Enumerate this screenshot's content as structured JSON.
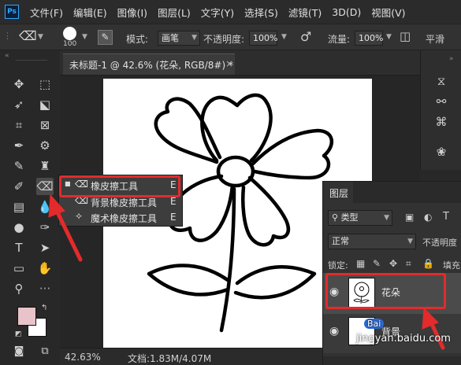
{
  "app": {
    "logo": "Ps"
  },
  "menu": [
    "文件(F)",
    "编辑(E)",
    "图像(I)",
    "图层(L)",
    "文字(Y)",
    "选择(S)",
    "滤镜(T)",
    "3D(D)",
    "视图(V)"
  ],
  "options": {
    "brush_size": "100",
    "mode_label": "模式:",
    "mode_value": "画笔",
    "opacity_label": "不透明度:",
    "opacity_value": "100%",
    "flow_label": "流量:",
    "flow_value": "100%",
    "smooth_label": "平滑"
  },
  "document": {
    "tab_title": "未标题-1 @ 42.6% (花朵, RGB/8#) *",
    "close": "×"
  },
  "status": {
    "zoom": "42.63%",
    "doc_size": "文档:1.83M/4.07M"
  },
  "flyout": {
    "items": [
      {
        "label": "橡皮擦工具",
        "key": "E",
        "icon": "eraser-icon"
      },
      {
        "label": "背景橡皮擦工具",
        "key": "E",
        "icon": "background-eraser-icon"
      },
      {
        "label": "魔术橡皮擦工具",
        "key": "E",
        "icon": "magic-eraser-icon"
      }
    ]
  },
  "layers_panel": {
    "tab": "图层",
    "filter_kind": "类型",
    "blend_mode": "正常",
    "opacity_label": "不透明度",
    "lock_label": "锁定:",
    "fill_label": "填充",
    "layers": [
      {
        "name": "花朵",
        "visible": true
      },
      {
        "name": "背景",
        "visible": true
      }
    ]
  },
  "colors": {
    "foreground": "#e9c3ca",
    "background": "#ffffff",
    "highlight": "#e32b2b"
  },
  "watermark": "jingyan.baidu.com",
  "watermark_logo": "Bai"
}
